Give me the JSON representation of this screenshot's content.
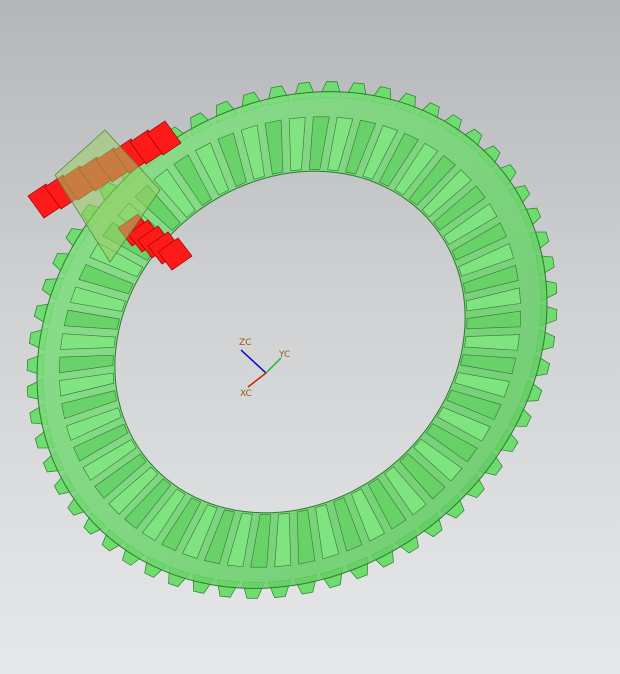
{
  "viewport": {
    "background_top": "#b4b6b9",
    "background_bottom": "#e6e8ea"
  },
  "model": {
    "ring_gear_color": "#6fdc6f",
    "ring_gear_edge_color": "#2f7a2f",
    "pinion_color": "#ff1a1a",
    "ring_gear_tooth_count": 60
  },
  "triad": {
    "zc_label": "ZC",
    "yc_label": "YC",
    "xc_label": "XC",
    "zc_color": "#0000cc",
    "yc_color": "#22bb22",
    "xc_color": "#cc2200",
    "label_color": "#9a5a1a"
  }
}
